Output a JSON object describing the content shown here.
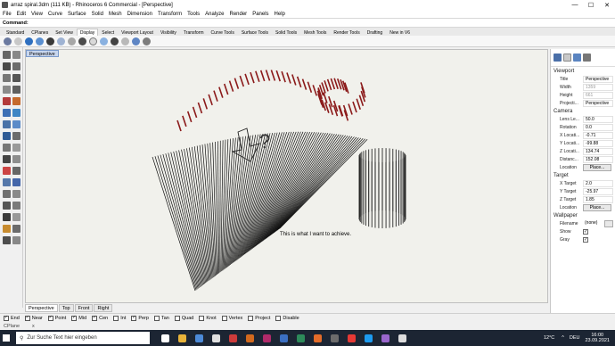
{
  "window": {
    "title": "arraz spiral.3dm (111 KB) - Rhinoceros 6 Commercial - [Perspective]",
    "controls": [
      "—",
      "☐",
      "✕"
    ]
  },
  "menu": [
    "File",
    "Edit",
    "View",
    "Curve",
    "Surface",
    "Solid",
    "Mesh",
    "Dimension",
    "Transform",
    "Tools",
    "Analyze",
    "Render",
    "Panels",
    "Help"
  ],
  "command": {
    "label": "Command:",
    "value": ""
  },
  "toolbar_tabs": [
    "Standard",
    "CPlanes",
    "Set View",
    "Display",
    "Select",
    "Viewport Layout",
    "Visibility",
    "Transform",
    "Curve Tools",
    "Surface Tools",
    "Solid Tools",
    "Mesh Tools",
    "Render Tools",
    "Drafting",
    "New in V6"
  ],
  "active_toolbar_tab": "Display",
  "viewport": {
    "label": "Perspective",
    "caption": "This is what I want to achieve.",
    "question_mark": "?"
  },
  "view_tabs": [
    "Perspective",
    "Top",
    "Front",
    "Right"
  ],
  "active_view_tab": "Perspective",
  "properties": {
    "viewport_header": "Viewport",
    "title_label": "Title",
    "title_value": "Perspective",
    "width_label": "Width",
    "width_value": "1359",
    "height_label": "Height",
    "height_value": "661",
    "projection_label": "Projecti...",
    "projection_value": "Perspective",
    "camera_header": "Camera",
    "lens_label": "Lens Le...",
    "lens_value": "50.0",
    "rotation_label": "Rotation",
    "rotation_value": "0.0",
    "xloc_label": "X Locati...",
    "xloc_value": "-0.71",
    "yloc_label": "Y Locati...",
    "yloc_value": "-99.88",
    "zloc_label": "Z Locati...",
    "zloc_value": "134.74",
    "distance_label": "Distanc...",
    "distance_value": "152.08",
    "cam_location_label": "Location",
    "cam_location_button": "Place...",
    "target_header": "Target",
    "xtarget_label": "X Target",
    "xtarget_value": "2.0",
    "ytarget_label": "Y Target",
    "ytarget_value": "-25.97",
    "ztarget_label": "Z Target",
    "ztarget_value": "1.85",
    "tgt_location_label": "Location",
    "tgt_location_button": "Place...",
    "wallpaper_header": "Wallpaper",
    "filename_label": "Filename",
    "filename_value": "(none)",
    "show_label": "Show",
    "show_checked": "✓",
    "gray_label": "Gray",
    "gray_checked": "✓"
  },
  "osnaps": [
    {
      "label": "End",
      "checked": "✓"
    },
    {
      "label": "Near",
      "checked": "✓"
    },
    {
      "label": "Point",
      "checked": "✓"
    },
    {
      "label": "Mid",
      "checked": "✓"
    },
    {
      "label": "Cen",
      "checked": "✓"
    },
    {
      "label": "Int",
      "checked": ""
    },
    {
      "label": "Perp",
      "checked": "✓"
    },
    {
      "label": "Tan",
      "checked": ""
    },
    {
      "label": "Quad",
      "checked": ""
    },
    {
      "label": "Knot",
      "checked": ""
    },
    {
      "label": "Vertex",
      "checked": ""
    },
    {
      "label": "Project",
      "checked": ""
    },
    {
      "label": "Disable",
      "checked": ""
    }
  ],
  "status": {
    "cplane": "CPlane",
    "x": "x"
  },
  "taskbar": {
    "search_placeholder": "Zur Suche Text hier eingeben",
    "temperature": "12°C",
    "language": "DEU",
    "time": "16:00",
    "date": "23.09.2021"
  },
  "colors": {
    "spiral_red": "#8b1a1a",
    "viewport_bg": "#f1f1ec",
    "taskbar_bg": "#1c2533"
  }
}
